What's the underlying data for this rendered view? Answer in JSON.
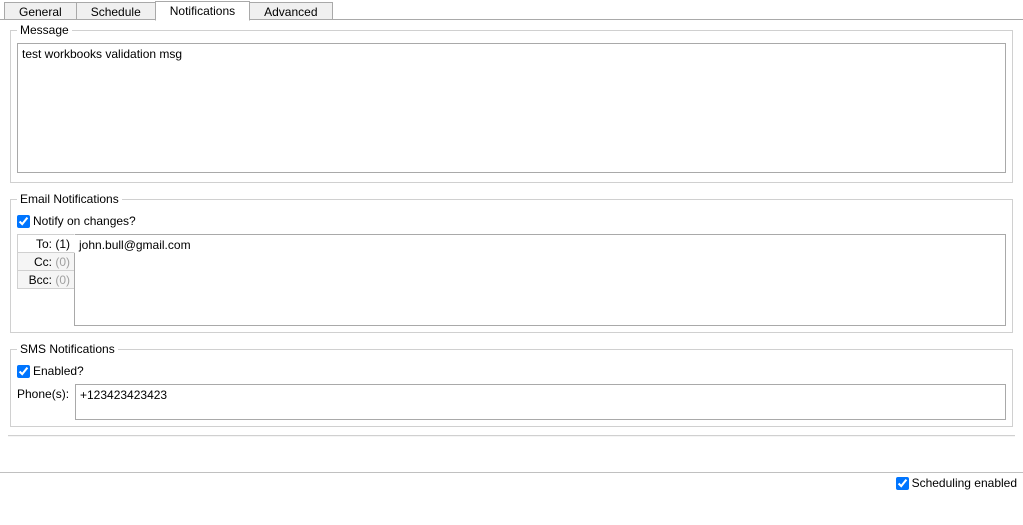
{
  "tabs": {
    "general": "General",
    "schedule": "Schedule",
    "notifications": "Notifications",
    "advanced": "Advanced"
  },
  "message": {
    "legend": "Message",
    "value": "test workbooks validation msg"
  },
  "email": {
    "legend": "Email Notifications",
    "notify_label": "Notify on changes?",
    "notify_checked": true,
    "to_label": "To:",
    "to_count": "(1)",
    "cc_label": "Cc:",
    "cc_count": "(0)",
    "bcc_label": "Bcc:",
    "bcc_count": "(0)",
    "addresses": "john.bull@gmail.com"
  },
  "sms": {
    "legend": "SMS Notifications",
    "enabled_label": "Enabled?",
    "enabled_checked": true,
    "phone_label": "Phone(s):",
    "phones": "+123423423423"
  },
  "footer": {
    "scheduling_label": "Scheduling enabled",
    "scheduling_checked": true
  }
}
